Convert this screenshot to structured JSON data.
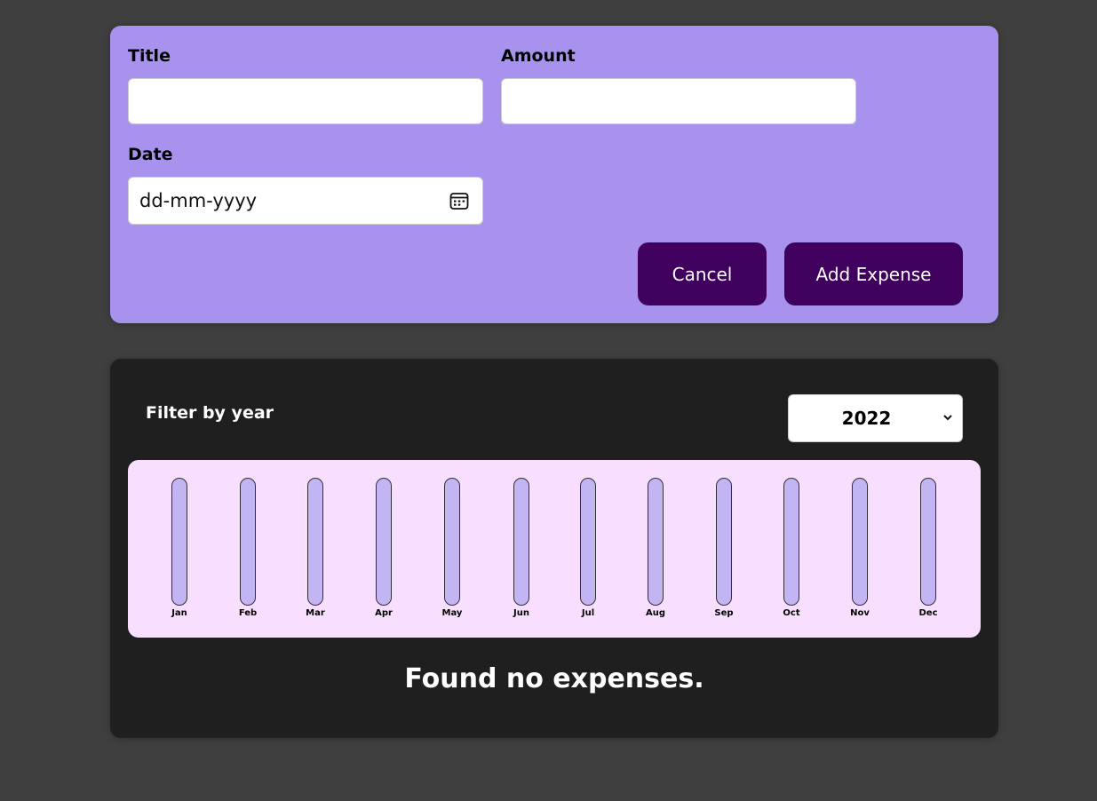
{
  "form": {
    "title_label": "Title",
    "title_value": "",
    "amount_label": "Amount",
    "amount_value": "",
    "date_label": "Date",
    "date_placeholder": "dd-mm-yyyy",
    "date_icon": "calendar-icon",
    "cancel_label": "Cancel",
    "submit_label": "Add Expense"
  },
  "filter": {
    "label": "Filter by year",
    "selected_year": "2022",
    "dropdown_icon": "chevron-down-icon"
  },
  "chart_data": {
    "type": "bar",
    "categories": [
      "Jan",
      "Feb",
      "Mar",
      "Apr",
      "May",
      "Jun",
      "Jul",
      "Aug",
      "Sep",
      "Oct",
      "Nov",
      "Dec"
    ],
    "values": [
      0,
      0,
      0,
      0,
      0,
      0,
      0,
      0,
      0,
      0,
      0,
      0
    ]
  },
  "empty_message": "Found no expenses.",
  "colors": {
    "page_bg": "#3f3f3f",
    "form_bg": "#a892ee",
    "button_bg": "#40005d",
    "list_bg": "#1f1f1f",
    "chart_bg": "#f8dfff",
    "bar_track": "#c3b4f3",
    "bar_fill": "#4826b9"
  }
}
